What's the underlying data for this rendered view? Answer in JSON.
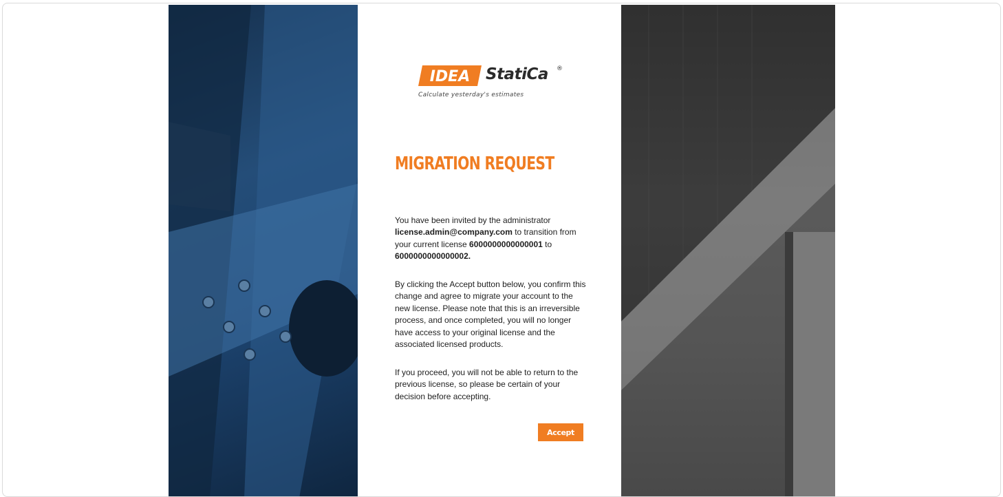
{
  "logo": {
    "mark_text": "IDEA",
    "word": "StatiCa",
    "registered": "®",
    "tagline": "Calculate yesterday's estimates"
  },
  "page": {
    "title": "MIGRATION REQUEST"
  },
  "message": {
    "p1_intro": "You have been invited by the administrator",
    "admin_email": "license.admin@company.com",
    "p1_transition": " to transition from your current license ",
    "current_license": "6000000000000001",
    "p1_to": " to ",
    "new_license": "6000000000000002."
  },
  "paragraphs": {
    "warning": "By clicking the Accept button below, you confirm this change and agree to migrate your account to the new license. Please note that this is an irreversible process, and once completed, you will no longer have access to your original license and the associated licensed products.",
    "final": "If you proceed, you will not be able to return to the previous license, so please be certain of your decision before accepting."
  },
  "actions": {
    "accept_label": "Accept"
  },
  "colors": {
    "accent": "#f07d22",
    "text": "#1e1e1e"
  }
}
